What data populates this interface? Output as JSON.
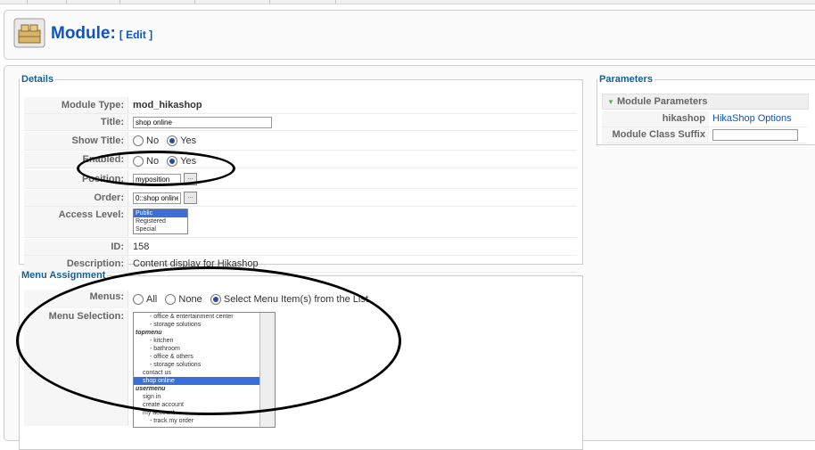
{
  "page": {
    "title": "Module:",
    "title_sub": "[ Edit ]"
  },
  "details": {
    "legend": "Details",
    "module_type": {
      "label": "Module Type:",
      "value": "mod_hikashop"
    },
    "title": {
      "label": "Title:",
      "value": "shop online"
    },
    "show_title": {
      "label": "Show Title:",
      "options": [
        "No",
        "Yes"
      ],
      "selected": "Yes"
    },
    "enabled": {
      "label": "Enabled:",
      "options": [
        "No",
        "Yes"
      ],
      "selected": "Yes"
    },
    "position": {
      "label": "Position:",
      "value": "myposition"
    },
    "order": {
      "label": "Order:",
      "value": "0::shop online"
    },
    "access_level": {
      "label": "Access Level:",
      "options": [
        "Public",
        "Registered",
        "Special"
      ],
      "selected": "Public"
    },
    "id": {
      "label": "ID:",
      "value": "158"
    },
    "description": {
      "label": "Description:",
      "value": "Content display for Hikashop"
    }
  },
  "menu_assignment": {
    "legend": "Menu Assignment",
    "menus": {
      "label": "Menus:",
      "options": [
        "All",
        "None",
        "Select Menu Item(s) from the List"
      ],
      "selected": "Select Menu Item(s) from the List"
    },
    "menu_selection": {
      "label": "Menu Selection:",
      "items": [
        {
          "text": "- office & entertainment center",
          "indent": 2,
          "type": "item"
        },
        {
          "text": "- storage solutions",
          "indent": 2,
          "type": "item"
        },
        {
          "text": "topmenu",
          "indent": 0,
          "type": "group"
        },
        {
          "text": "- kitchen",
          "indent": 2,
          "type": "item"
        },
        {
          "text": "- bathroom",
          "indent": 2,
          "type": "item"
        },
        {
          "text": "- office & others",
          "indent": 2,
          "type": "item"
        },
        {
          "text": "- storage solutions",
          "indent": 2,
          "type": "item"
        },
        {
          "text": "contact us",
          "indent": 1,
          "type": "item"
        },
        {
          "text": "shop online",
          "indent": 1,
          "type": "selected"
        },
        {
          "text": "usermenu",
          "indent": 0,
          "type": "group"
        },
        {
          "text": "sign in",
          "indent": 1,
          "type": "item"
        },
        {
          "text": "create account",
          "indent": 1,
          "type": "item"
        },
        {
          "text": "my account",
          "indent": 1,
          "type": "item"
        },
        {
          "text": "- track my order",
          "indent": 2,
          "type": "item"
        }
      ]
    }
  },
  "parameters": {
    "legend": "Parameters",
    "panel_title": "Module Parameters",
    "hikashop": {
      "label": "hikashop",
      "value": "HikaShop Options"
    },
    "module_class_suffix": {
      "label": "Module Class Suffix",
      "value": ""
    }
  },
  "colors": {
    "accent": "#0b55c4",
    "legend": "#146295",
    "selection": "#3a6fd8"
  }
}
